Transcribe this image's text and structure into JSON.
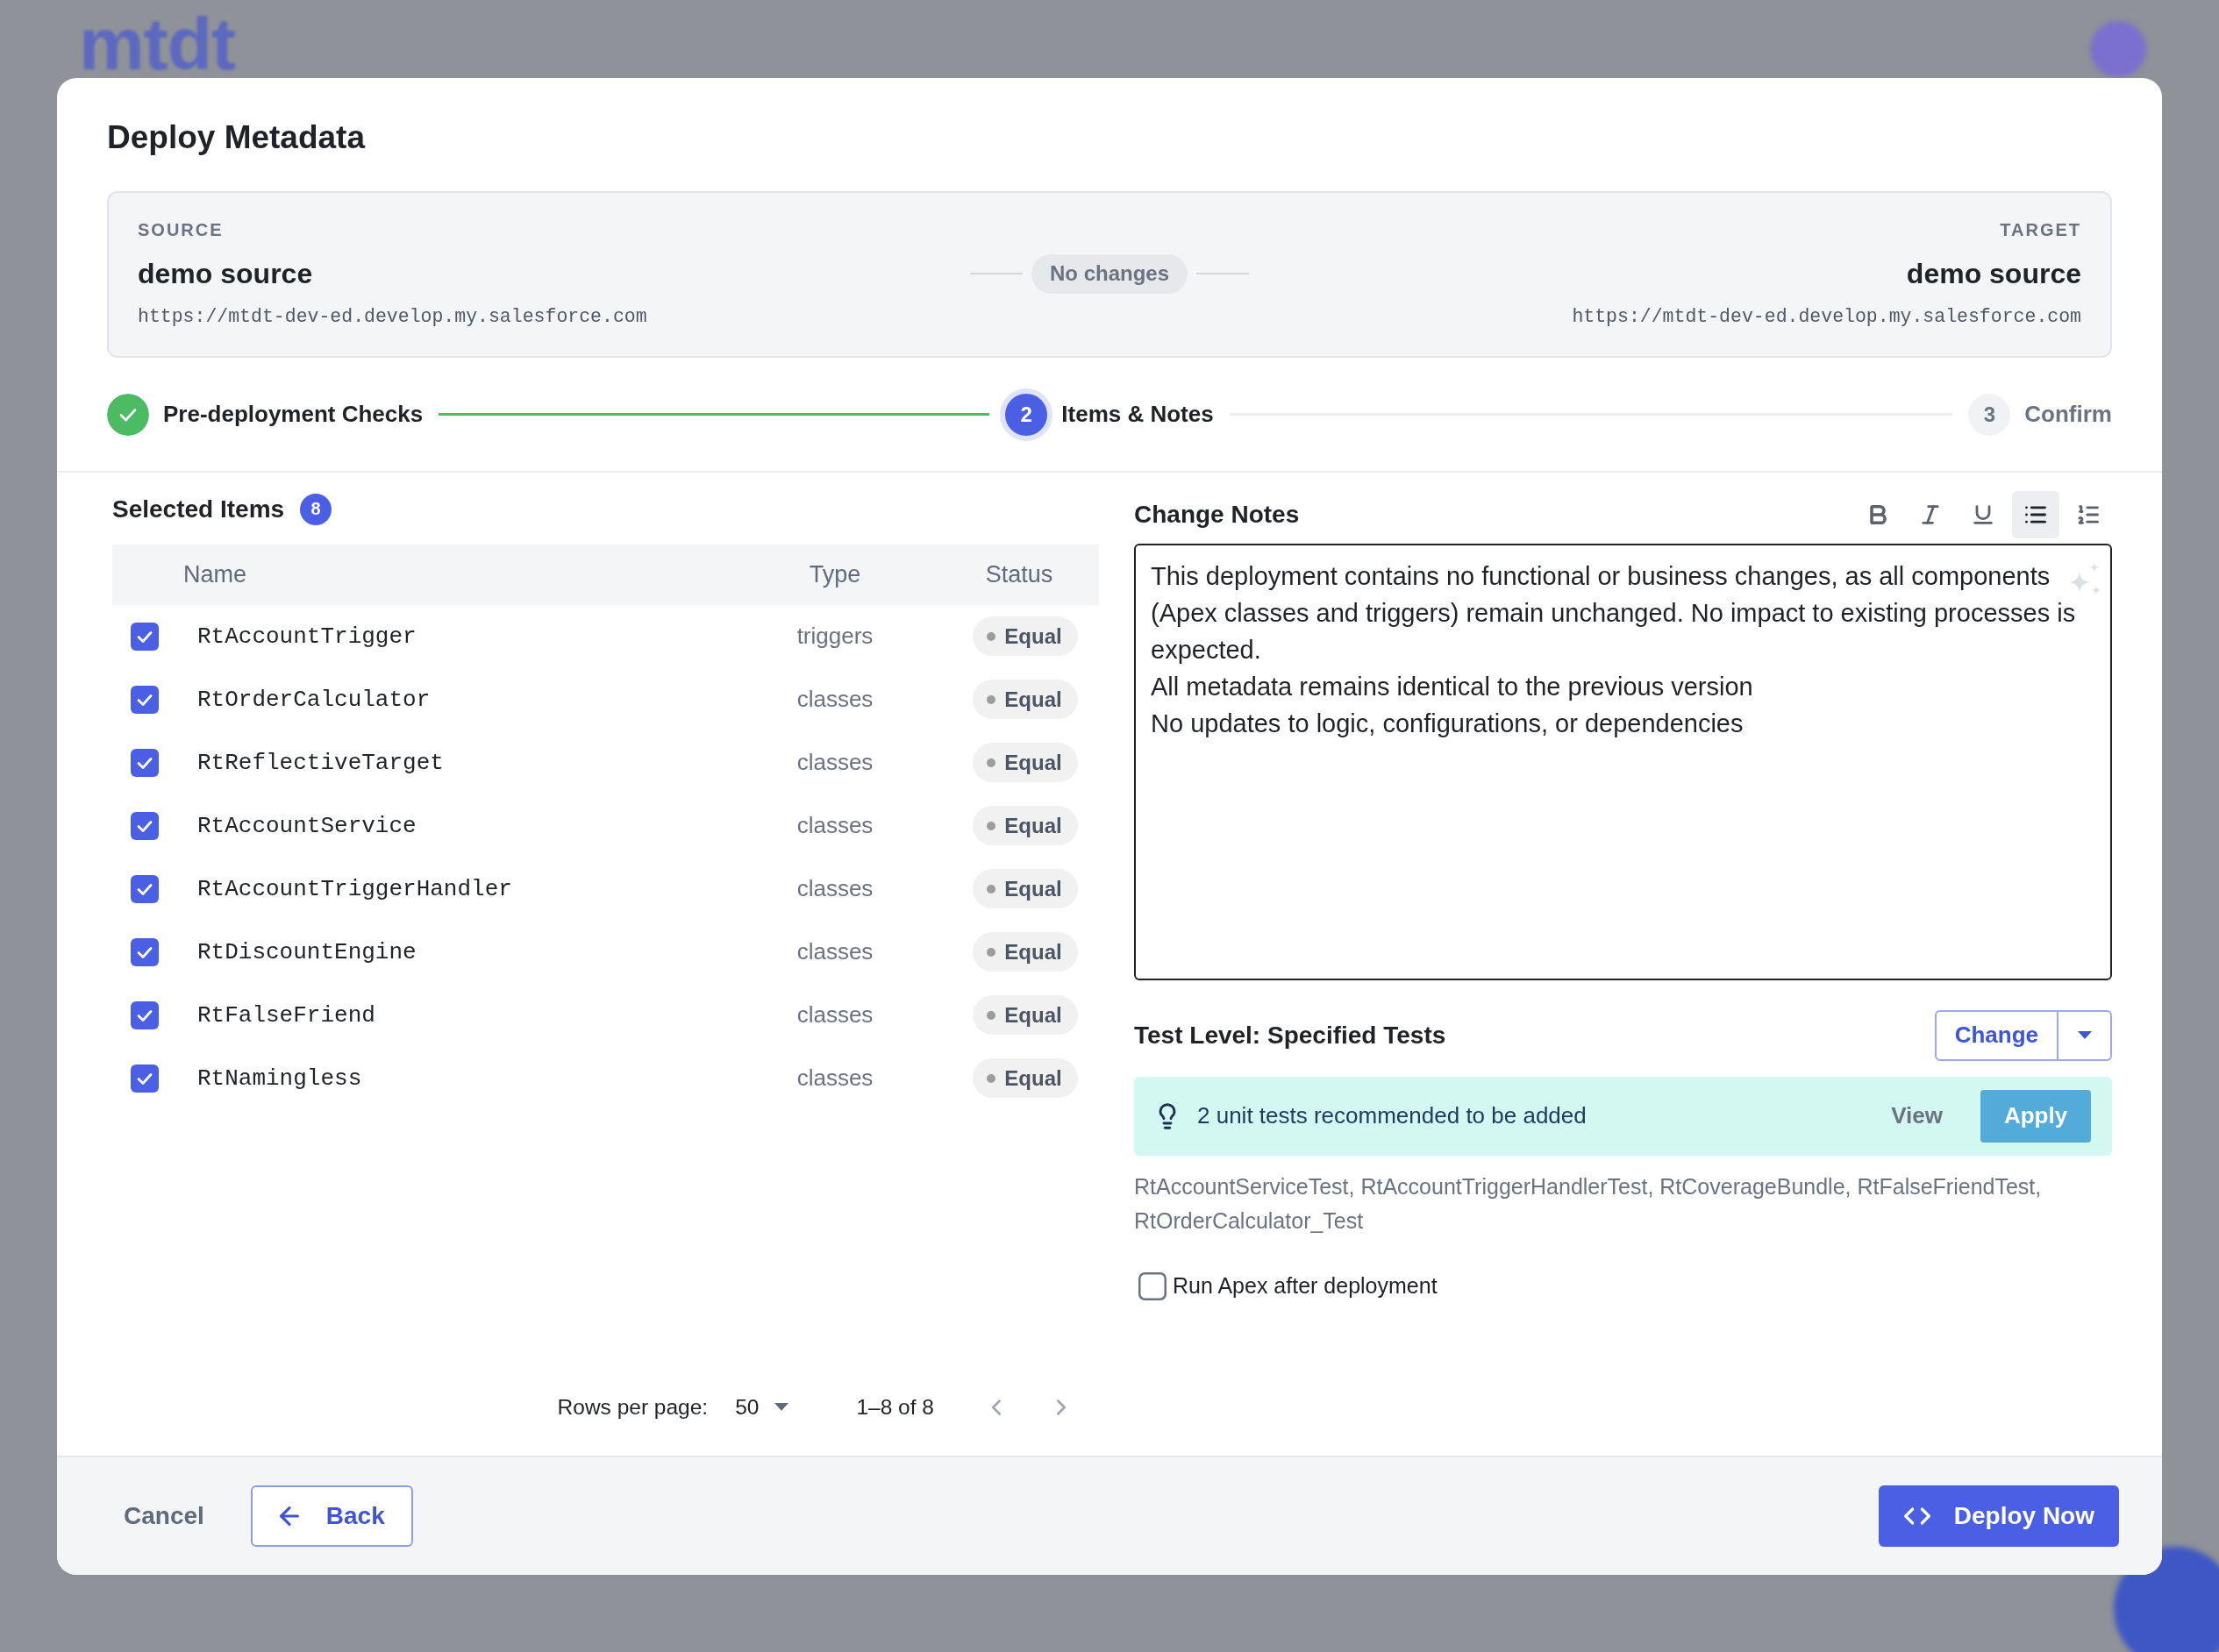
{
  "background": {
    "logo": "mtdt"
  },
  "dialog": {
    "title": "Deploy Metadata",
    "comparison": {
      "source": {
        "label": "SOURCE",
        "name": "demo source",
        "url": "https://mtdt-dev-ed.develop.my.salesforce.com"
      },
      "status": "No changes",
      "target": {
        "label": "TARGET",
        "name": "demo source",
        "url": "https://mtdt-dev-ed.develop.my.salesforce.com"
      }
    },
    "steps": [
      {
        "label": "Pre-deployment Checks",
        "completed": true,
        "selected": false
      },
      {
        "number": "2",
        "label": "Items & Notes",
        "completed": false,
        "selected": true
      },
      {
        "number": "3",
        "label": "Confirm",
        "completed": false,
        "selected": false
      }
    ],
    "selected_items": {
      "title": "Selected Items",
      "count": "8",
      "columns": [
        "Name",
        "Type",
        "Status"
      ],
      "rows": [
        {
          "checked": true,
          "name": "RtAccountTrigger",
          "type": "triggers",
          "status": "Equal"
        },
        {
          "checked": true,
          "name": "RtOrderCalculator",
          "type": "classes",
          "status": "Equal"
        },
        {
          "checked": true,
          "name": "RtReflectiveTarget",
          "type": "classes",
          "status": "Equal"
        },
        {
          "checked": true,
          "name": "RtAccountService",
          "type": "classes",
          "status": "Equal"
        },
        {
          "checked": true,
          "name": "RtAccountTriggerHandler",
          "type": "classes",
          "status": "Equal"
        },
        {
          "checked": true,
          "name": "RtDiscountEngine",
          "type": "classes",
          "status": "Equal"
        },
        {
          "checked": true,
          "name": "RtFalseFriend",
          "type": "classes",
          "status": "Equal"
        },
        {
          "checked": true,
          "name": "RtNamingless",
          "type": "classes",
          "status": "Equal"
        }
      ],
      "pagination": {
        "rows_per_page_label": "Rows per page:",
        "rows_per_page": "50",
        "range": "1–8 of 8"
      }
    },
    "change_notes": {
      "title": "Change Notes",
      "toolbar": [
        {
          "kind": "bold",
          "selected": false
        },
        {
          "kind": "italic",
          "selected": false
        },
        {
          "kind": "underline",
          "selected": false
        },
        {
          "kind": "bullet_list",
          "selected": true
        },
        {
          "kind": "numbered_list",
          "selected": false
        }
      ],
      "paragraphs": [
        "This deployment contains no functional or business changes, as all components (Apex classes and triggers) remain unchanged. No impact to existing processes is expected.",
        "All metadata remains identical to the previous version",
        "No updates to logic, configurations, or dependencies"
      ]
    },
    "test_level": {
      "label": "Test Level: Specified Tests",
      "button": "Change"
    },
    "recommendation": {
      "message": "2 unit tests recommended to be added",
      "view": "View",
      "apply": "Apply",
      "tests": "RtAccountServiceTest, RtAccountTriggerHandlerTest, RtCoverageBundle, RtFalseFriendTest, RtOrderCalculator_Test"
    },
    "run_apex": {
      "label": "Run Apex after deployment",
      "checked": false
    },
    "footer": {
      "cancel": "Cancel",
      "back": "Back",
      "deploy": "Deploy Now"
    }
  }
}
